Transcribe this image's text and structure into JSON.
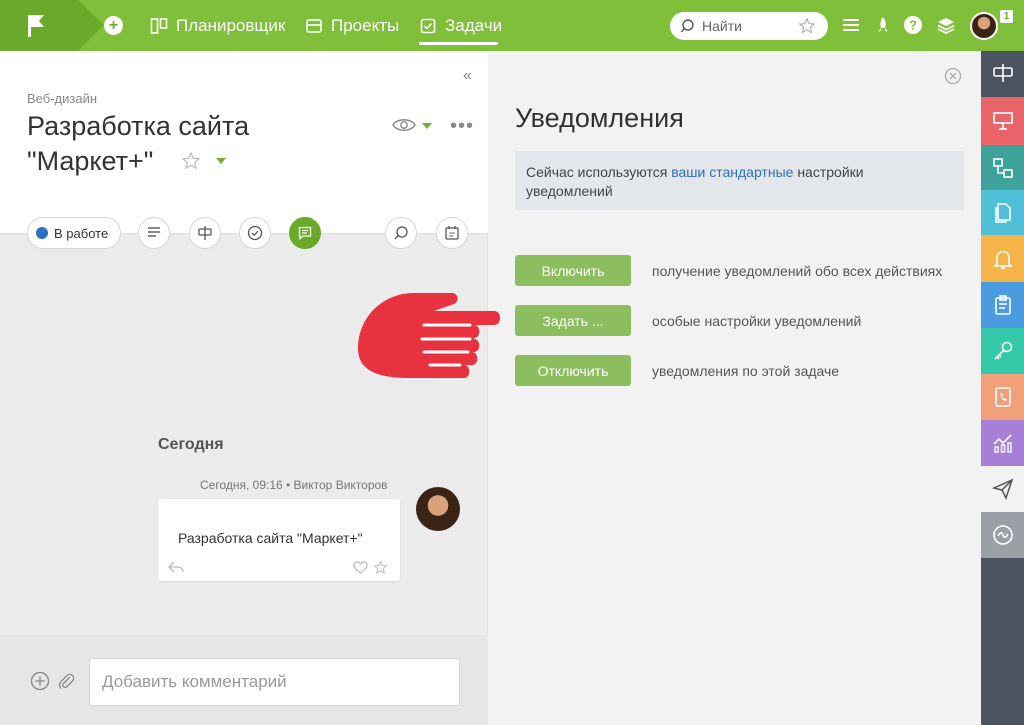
{
  "topbar": {
    "nav": [
      {
        "label": "Планировщик",
        "icon": "planner-icon"
      },
      {
        "label": "Проекты",
        "icon": "projects-icon"
      },
      {
        "label": "Задачи",
        "icon": "tasks-icon"
      }
    ],
    "search_placeholder": "Найти",
    "notification_count": "1"
  },
  "task": {
    "project": "Веб-дизайн",
    "title": "Разработка сайта \"Маркет+\"",
    "status": "В работе"
  },
  "feed": {
    "today": "Сегодня",
    "message": {
      "meta": "Сегодня, 09:16 • Виктор Викторов",
      "text": "Разработка сайта \"Маркет+\""
    }
  },
  "comment": {
    "placeholder": "Добавить комментарий"
  },
  "notifications": {
    "title": "Уведомления",
    "info_prefix": "Сейчас используются ",
    "info_link": "ваши стандартные",
    "info_suffix": " настройки уведомлений",
    "options": [
      {
        "button": "Включить",
        "desc": "получение уведомлений обо всех действиях"
      },
      {
        "button": "Задать ...",
        "desc": "особые настройки уведомлений"
      },
      {
        "button": "Отключить",
        "desc": "уведомления по этой задаче"
      }
    ]
  },
  "colors": {
    "brand_green": "#7fbf3a",
    "button_green": "#8cbd5e",
    "status_blue": "#2f6fbf",
    "hand_red": "#e8323f",
    "sidebar_dark": "#4c5360"
  },
  "right_sidebar": [
    {
      "icon": "signpost-icon",
      "color": "#4c5360"
    },
    {
      "icon": "board-icon",
      "color": "#e8636a"
    },
    {
      "icon": "diagram-icon",
      "color": "#3fa29a"
    },
    {
      "icon": "documents-icon",
      "color": "#4fc0d8"
    },
    {
      "icon": "bell-icon",
      "color": "#f5b54a"
    },
    {
      "icon": "clipboard-icon",
      "color": "#4a9be0"
    },
    {
      "icon": "key-icon",
      "color": "#34c9a8"
    },
    {
      "icon": "contacts-icon",
      "color": "#f2a07a"
    },
    {
      "icon": "analytics-icon",
      "color": "#a77fd6"
    },
    {
      "icon": "send-icon",
      "color": "#f2f2f2"
    },
    {
      "icon": "wave-icon",
      "color": "#9b9fa6"
    }
  ]
}
